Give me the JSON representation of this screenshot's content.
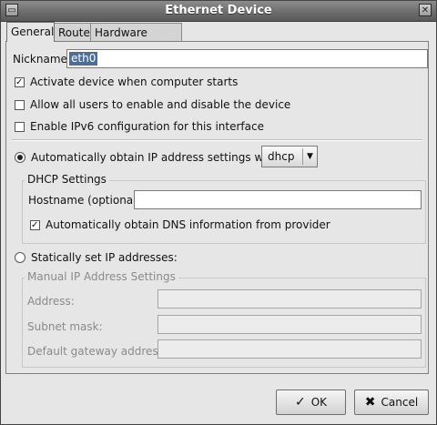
{
  "window": {
    "title": "Ethernet Device"
  },
  "tabs": [
    {
      "label": "General"
    },
    {
      "label": "Route"
    },
    {
      "label": "Hardware Device"
    }
  ],
  "general": {
    "nickname_label": "Nickname:",
    "nickname_value": "eth0",
    "options": [
      {
        "label": "Activate device when computer starts",
        "checked": true
      },
      {
        "label": "Allow all users to enable and disable the device",
        "checked": false
      },
      {
        "label": "Enable IPv6 configuration for this interface",
        "checked": false
      }
    ],
    "auto_ip_label": "Automatically obtain IP address settings with:",
    "auto_ip_selected": true,
    "auto_ip_method": "dhcp",
    "dhcp": {
      "title": "DHCP Settings",
      "hostname_label": "Hostname (optional):",
      "hostname_value": "",
      "dns_label": "Automatically obtain DNS information from provider",
      "dns_checked": true
    },
    "static_label": "Statically set IP addresses:",
    "static_selected": false,
    "manual": {
      "title": "Manual IP Address Settings",
      "address_label": "Address:",
      "subnet_label": "Subnet mask:",
      "gateway_label": "Default gateway address:"
    }
  },
  "buttons": {
    "ok": "OK",
    "cancel": "Cancel"
  }
}
